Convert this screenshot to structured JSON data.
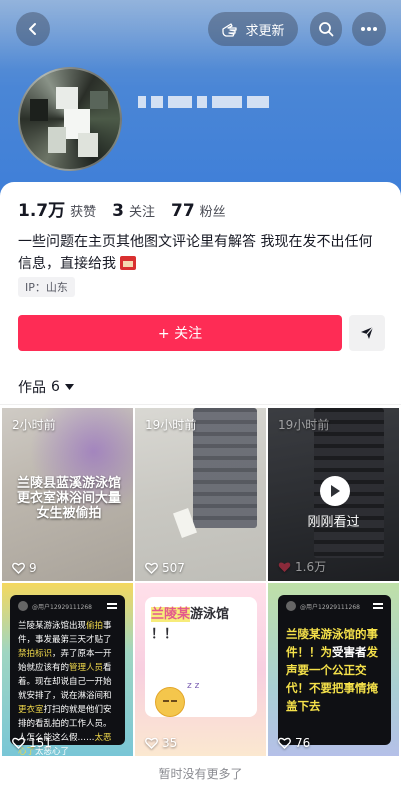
{
  "header": {
    "update_label": "求更新"
  },
  "profile": {
    "stats": [
      {
        "num": "1.7万",
        "label": "获赞"
      },
      {
        "num": "3",
        "label": "关注"
      },
      {
        "num": "77",
        "label": "粉丝"
      }
    ],
    "bio": "一些问题在主页其他图文评论里有解答 我现在发不出任何信息，直接给我",
    "ip": "IP：山东",
    "follow_label": "+ 关注"
  },
  "works": {
    "tab_label": "作品",
    "count": "6"
  },
  "tiles": [
    {
      "time": "2小时前",
      "caption": "兰陵县蓝溪游泳馆更衣室淋浴间大量女生被偷拍",
      "likes": "9"
    },
    {
      "time": "19小时前",
      "likes": "507"
    },
    {
      "time": "19小时前",
      "overlay": "刚刚看过",
      "likes": "1.6万"
    },
    {
      "header_name": "@用户12929111268",
      "likes": "151"
    },
    {
      "likes": "35"
    },
    {
      "header_name": "@用户12929111268",
      "likes": "76"
    }
  ],
  "tile4_text": {
    "p1": "兰陵某游泳馆出现",
    "hl1": "偷拍",
    "p2": "事件，事发最第三天才贴了",
    "hl2": "禁拍标识",
    "p3": "，弄了原本一开始就应该有的",
    "hl3": "管理人员",
    "p4": "看着。现在却说自己一开始就安排了，说在淋浴间和",
    "hl4": "更衣室",
    "p5": "打扫的就是他们安排的看乱拍的工作人员。人怎么能这么假……",
    "hl5": "太恶心了",
    "p6": "太恶心了"
  },
  "tile5_text": {
    "hl": "兰陵某",
    "rest": "游泳馆",
    "tail": "！！",
    "zz": "z z"
  },
  "tile6_text": {
    "p1": "兰陵某游泳馆的事件！！为",
    "w1": "受害者",
    "p2": "发声要一个公正交代！不要把事情掩盖下去"
  },
  "footer": "暂时没有更多了",
  "colors": {
    "accent": "#fe2c55",
    "cover": "#3f7fd8"
  }
}
